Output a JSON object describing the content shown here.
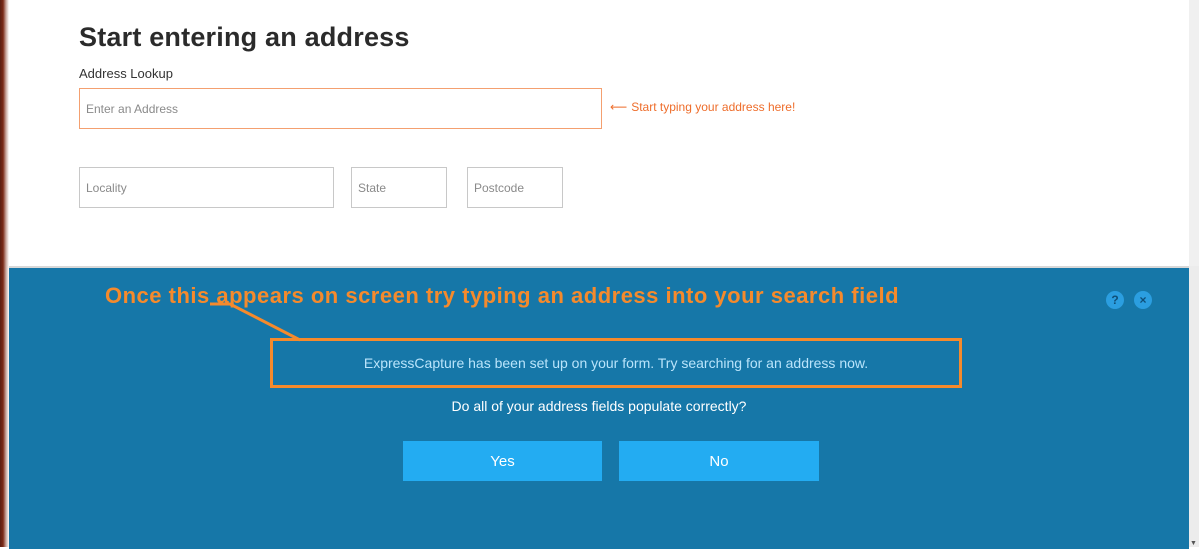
{
  "form": {
    "heading": "Start entering an address",
    "lookup_label": "Address Lookup",
    "address_placeholder": "Enter an Address",
    "hint": "Start typing your address here!",
    "locality_placeholder": "Locality",
    "state_placeholder": "State",
    "postcode_placeholder": "Postcode"
  },
  "panel": {
    "annotation": "Once this appears on screen try typing an address into your search field",
    "message": "ExpressCapture has been set up on your form. Try searching for an address now.",
    "question": "Do all of your address fields populate correctly?",
    "yes_label": "Yes",
    "no_label": "No",
    "help_icon": "?",
    "close_icon": "×"
  },
  "colors": {
    "panel_bg": "#1677a8",
    "accent_orange": "#f58a2c",
    "button_bg": "#23acf2"
  }
}
